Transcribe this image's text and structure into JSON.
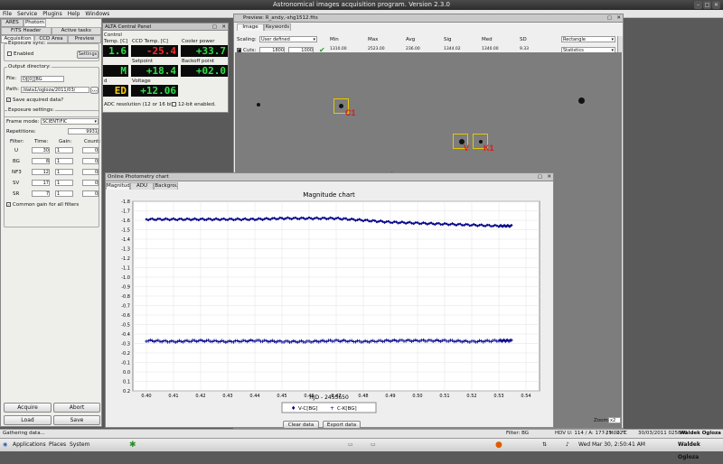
{
  "window": {
    "title": "Astronomical images acquisition program. Version 2.3.0"
  },
  "menu": [
    "File",
    "Service",
    "Plugins",
    "Help",
    "Windows"
  ],
  "left": {
    "tabs_row1": [
      "ARES",
      "Photom"
    ],
    "tabs_row2": [
      "FITS Header",
      "Active tasks"
    ],
    "tabs_row3": [
      "Acquisition",
      "CCD Area",
      "Preview"
    ],
    "sync_title": "Exposure sync:",
    "enabled_label": "Enabled",
    "settings_btn": "Settings",
    "outdir_title": "Output directory:",
    "file_label": "File:",
    "file_value": "DJ[0]]BG",
    "path_label": "Path:",
    "path_value": "/data1/ogloza/2011/03/",
    "browse_btn": "...",
    "save_label": "Save acquired data?",
    "exp_title": "Exposure settings:",
    "frame_label": "Frame mode:",
    "frame_value": "SCIENTIFIC",
    "rep_label": "Repetitions:",
    "rep_value": "9931",
    "col_filter": "Filter:",
    "col_time": "Time:",
    "col_gain": "Gain:",
    "col_count": "Count:",
    "filters": [
      {
        "name": "U",
        "time": "30",
        "gain": "1",
        "count": "0"
      },
      {
        "name": "BG",
        "time": "8",
        "gain": "1",
        "count": "0"
      },
      {
        "name": "NF3",
        "time": "12",
        "gain": "1",
        "count": "0"
      },
      {
        "name": "SV",
        "time": "17",
        "gain": "1",
        "count": "0"
      },
      {
        "name": "SR",
        "time": "7",
        "gain": "1",
        "count": "0"
      }
    ],
    "common_gain": "Common gain for all filters",
    "acquire": "Acquire",
    "abort": "Abort",
    "load": "Load",
    "save": "Save"
  },
  "alta": {
    "title": "ALTA Central Panel",
    "head_row": "Control",
    "l1": "Temp. [C]",
    "l2": "CCD Temp. [C]",
    "l3": "Cooler power",
    "v1": "1.6",
    "v2": "-25.4",
    "v3": "+33.7",
    "l4": "Setpoint",
    "l5": "Backoff point",
    "v4": "M",
    "v5": "+18.4",
    "v6": "+02.0",
    "l6": "d",
    "l7": "Voltage",
    "v7": "ED",
    "v8": "+12.06",
    "adc": "ADC resolution (12 or 16 bit):",
    "bit12": "12-bit enabled."
  },
  "preview": {
    "title": "Preview: R_andy,-shg1512.fits",
    "tabs": [
      "Image",
      "Keywords"
    ],
    "scaling_label": "Scaling:",
    "scaling_value": "User defined",
    "cuts_label": "Cuts:",
    "cut_low": "1800",
    "cut_high": "1000",
    "stats_headers": [
      "Min",
      "Max",
      "Avg",
      "Sig",
      "Med",
      "SD"
    ],
    "stats_values": [
      "1310.00",
      "2523.00",
      "236.00",
      "1344.02",
      "1340.00",
      "9.33"
    ],
    "shape": "Rectangle",
    "stats_mode": "Statistics",
    "labels": [
      "C1",
      "V",
      "K1"
    ],
    "zoom_label": "Zoom:",
    "zoom_value": "x2"
  },
  "phot": {
    "title": "Online Photometry chart",
    "tabs": [
      "Magnitude",
      "ADU",
      "Background"
    ],
    "clear_btn": "Clear data",
    "export_btn": "Export data"
  },
  "chart_data": {
    "type": "scatter",
    "title": "Magnitude chart",
    "xlabel": "HJD - 2455650",
    "ylabel": "",
    "xlim": [
      0.395,
      0.545
    ],
    "ylim": [
      -1.8,
      0.2
    ],
    "y_inverted": true,
    "xticks": [
      "0.40",
      "0.41",
      "0.42",
      "0.43",
      "0.44",
      "0.45",
      "0.46",
      "0.47",
      "0.48",
      "0.49",
      "0.50",
      "0.51",
      "0.52",
      "0.53",
      "0.54"
    ],
    "yticks": [
      "-1.8",
      "-1.7",
      "-1.6",
      "-1.5",
      "-1.4",
      "-1.3",
      "-1.2",
      "-1.1",
      "-1.0",
      "-0.9",
      "-0.8",
      "-0.7",
      "-0.6",
      "-0.5",
      "-0.4",
      "-0.3",
      "-0.2",
      "-0.1",
      "0.0",
      "0.1",
      "0.2"
    ],
    "grid": true,
    "legend": "bottom-center",
    "series": [
      {
        "name": "V-C[BG]",
        "color": "#00008b",
        "marker": "diamond",
        "x": [
          0.4,
          0.41,
          0.42,
          0.43,
          0.44,
          0.45,
          0.46,
          0.47,
          0.48,
          0.49,
          0.5,
          0.51,
          0.52,
          0.53,
          0.535
        ],
        "y": [
          -1.61,
          -1.61,
          -1.61,
          -1.61,
          -1.61,
          -1.62,
          -1.62,
          -1.62,
          -1.6,
          -1.58,
          -1.57,
          -1.56,
          -1.55,
          -1.54,
          -1.54
        ]
      },
      {
        "name": "C-K[BG]",
        "color": "#00008b",
        "marker": "plus",
        "x": [
          0.4,
          0.41,
          0.42,
          0.43,
          0.44,
          0.45,
          0.46,
          0.47,
          0.48,
          0.49,
          0.5,
          0.51,
          0.52,
          0.53,
          0.535
        ],
        "y": [
          -0.33,
          -0.32,
          -0.33,
          -0.32,
          -0.33,
          -0.32,
          -0.32,
          -0.33,
          -0.32,
          -0.33,
          -0.33,
          -0.33,
          -0.32,
          -0.33,
          -0.33
        ]
      }
    ]
  },
  "status": {
    "left": "Gathering data...",
    "filter": "Filter: BG",
    "coords": "HDV U: 114 / A: 177 / H: 227",
    "temp": "-25.00 °C",
    "datetime": "30/03/2011 025840",
    "user": "Waldek Ogloza"
  },
  "taskbar": {
    "apps": "Applications",
    "places": "Places",
    "system": "System",
    "clock": "Wed Mar 30, 2:50:41 AM"
  }
}
